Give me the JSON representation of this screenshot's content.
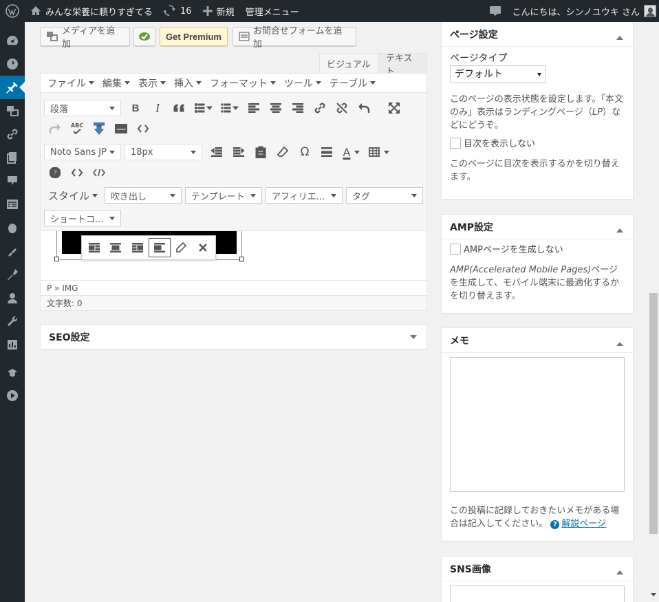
{
  "adminbar": {
    "site_title": "みんな栄養に頼りすぎてる",
    "updates_count": "16",
    "new_label": "新規",
    "admin_menu_label": "管理メニュー",
    "greeting": "こんにちは、シンノユウキ さん"
  },
  "sidebar": {
    "items": [
      "dashboard-icon",
      "jetpack-icon",
      "posts-icon",
      "media-icon",
      "links-icon",
      "pages-icon",
      "comments-icon",
      "forms-icon",
      "appearance-icon",
      "plugins-icon",
      "users-icon",
      "tools-icon",
      "settings-icon",
      "cocoon-icon",
      "video-icon"
    ]
  },
  "media_buttons": {
    "add_media": "メディアを追加",
    "get_premium": "Get Premium",
    "add_contact_form": "お問合せフォームを追加"
  },
  "editor_tabs": {
    "visual": "ビジュアル",
    "text": "テキスト"
  },
  "menubar": [
    "ファイル",
    "編集",
    "表示",
    "挿入",
    "フォーマット",
    "ツール",
    "テーブル"
  ],
  "toolbar": {
    "format_select": "段落",
    "font_select": "Noto Sans JP",
    "size_select": "18px",
    "bold": "B",
    "italic": "I",
    "abc": "ABC",
    "omega": "Ω",
    "a_label": "A",
    "style_select": "スタイル",
    "balloon_select": "吹き出し",
    "template_select": "テンプレート",
    "affiliate_select": "アフィリエ...",
    "tag_select": "タグ",
    "shortcode_select": "ショートコ..."
  },
  "statusbar": {
    "path": "P » IMG",
    "wordcount": "文字数: 0"
  },
  "seo_panel": {
    "title": "SEO設定"
  },
  "page_settings": {
    "title": "ページ設定",
    "page_type_label": "ページタイプ",
    "page_type_value": "デフォルト",
    "description_a": "このページの表示状態を設定します。「本文のみ」表示はランディングページ（",
    "description_lp": "LP",
    "description_b": "）などにどうぞ。",
    "toc_label": "目次を表示しない",
    "toc_note": "このページに目次を表示するかを切り替えます。"
  },
  "amp_settings": {
    "title": "AMP設定",
    "checkbox_label": "AMPページを生成しない",
    "note_em": "AMP(Accelerated Mobile Pages)",
    "note_rest": "ページを生成して、モバイル端末に最適化するかを切り替えます。"
  },
  "memo": {
    "title": "メモ",
    "textarea_value": "",
    "note": "この投稿に記録しておきたいメモがある場合は記入してください。",
    "help_link": "解説ページ"
  },
  "sns_image": {
    "title": "SNS画像"
  }
}
